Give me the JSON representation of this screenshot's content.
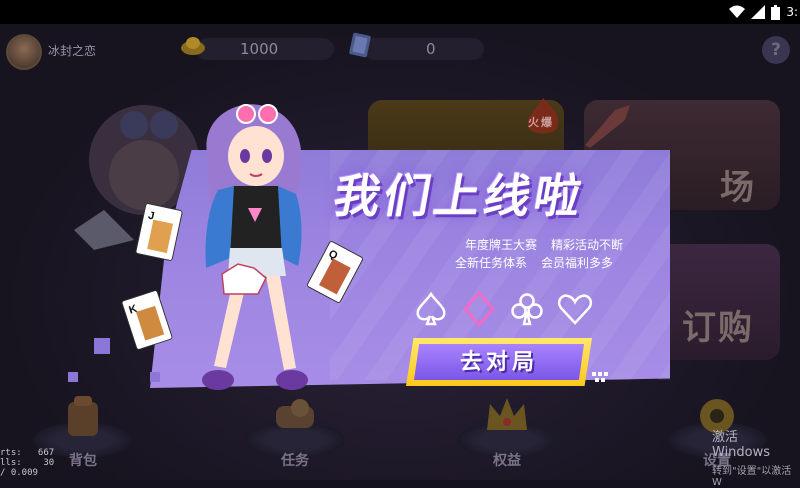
{
  "status_bar": {
    "time": "3:"
  },
  "header": {
    "username": "冰封之恋",
    "gold_amount": "1000",
    "card_amount": "0",
    "help_label": "?"
  },
  "rooms": {
    "hot_badge": "火爆",
    "room_2_label": "场",
    "room_3_label": "订购"
  },
  "popup": {
    "headline": "我们上线啦",
    "features": [
      [
        "年度牌王大赛",
        "精彩活动不断"
      ],
      [
        "全新任务体系",
        "会员福利多多"
      ]
    ],
    "play_button": "去对局"
  },
  "bottom_nav": [
    {
      "label": "背包",
      "icon": "backpack-icon"
    },
    {
      "label": "任务",
      "icon": "task-scroll-icon"
    },
    {
      "label": "权益",
      "icon": "crown-icon"
    },
    {
      "label": "设置",
      "icon": "gear-icon"
    }
  ],
  "debug": {
    "line1": "rts:   667",
    "line2": "lls:    30",
    "line3": "/ 0.009"
  },
  "watermark": {
    "line1": "激活 Windows",
    "line2": "转到\"设置\"以激活 W"
  },
  "colors": {
    "popup_purple": "#9a83e0",
    "button_yellow": "#fcc81c",
    "button_purple": "#7a56e6",
    "background": "#15121f"
  }
}
